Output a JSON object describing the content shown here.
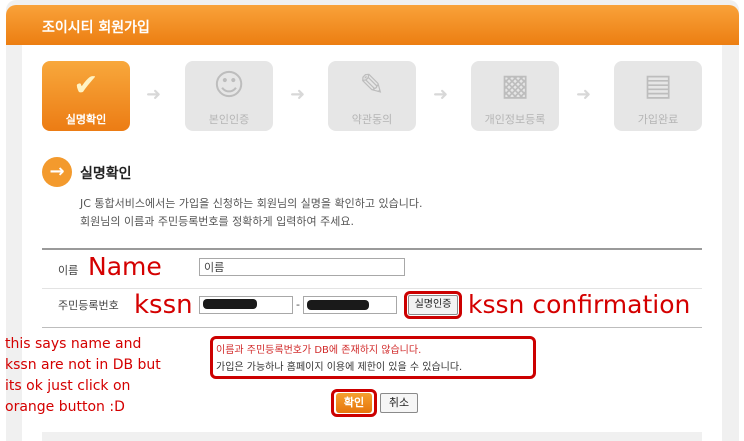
{
  "header": {
    "title": "조이시티 회원가입"
  },
  "steps": [
    {
      "label": "실명확인",
      "icon": "checklist-icon",
      "active": true
    },
    {
      "label": "본인인증",
      "icon": "person-question-icon",
      "active": false
    },
    {
      "label": "약관동의",
      "icon": "clipboard-icon",
      "active": false
    },
    {
      "label": "개인정보등록",
      "icon": "id-card-icon",
      "active": false
    },
    {
      "label": "가입완료",
      "icon": "documents-icon",
      "active": false
    }
  ],
  "section": {
    "title": "실명확인",
    "desc_line1": "JC 통합서비스에서는 가입을 신청하는 회원님의 실명을 확인하고 있습니다.",
    "desc_line2": "회원님의 이름과 주민등록번호를 정확하게 입력하여 주세요."
  },
  "form": {
    "name_label": "이름",
    "name_value": "이름",
    "ssn_label": "주민등록번호",
    "ssn_separator": "-",
    "verify_button": "실명인증"
  },
  "message": {
    "line1": "이름과 주민등록번호가 DB에 존재하지 않습니다.",
    "line2": "가입은 가능하나 홈페이지 이용에 제한이 있을 수 있습니다."
  },
  "buttons": {
    "confirm": "확인",
    "cancel": "취소"
  },
  "annotations": {
    "name": "Name",
    "kssn": "kssn",
    "kssn_confirmation": "kssn confirmation",
    "note_line1": "this says name and",
    "note_line2": "kssn are not in DB but",
    "note_line3": "its ok just click on",
    "note_line4": "orange button :D"
  },
  "colors": {
    "accent": "#ec7e12",
    "annotation": "#d40000",
    "error_text": "#d12a2a"
  }
}
